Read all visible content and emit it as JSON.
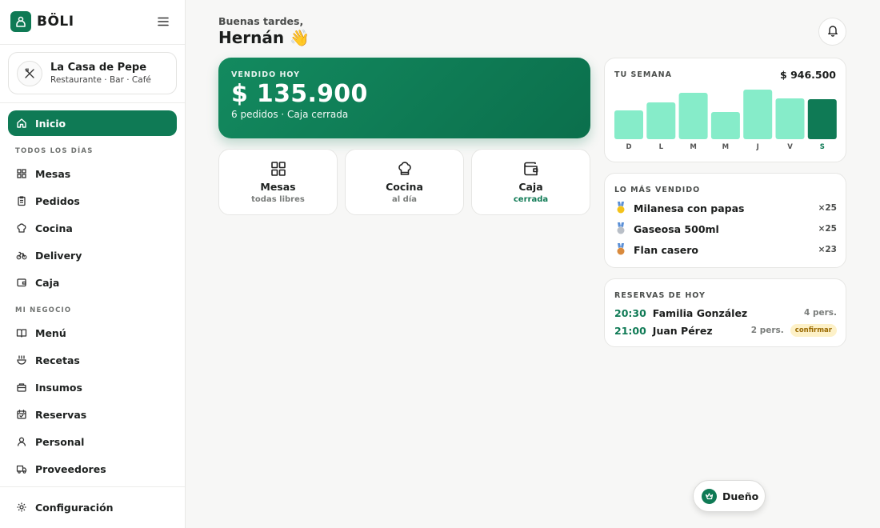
{
  "brand": {
    "name": "BÖLI",
    "accent": "#0f7a55"
  },
  "business": {
    "name": "La Casa de Pepe",
    "type": "Restaurante · Bar · Café"
  },
  "sidebar": {
    "active": {
      "label": "Inicio",
      "icon": "home-icon"
    },
    "section_daily": "TODOS LOS DÍAS",
    "daily": [
      {
        "label": "Mesas",
        "icon": "grid-icon"
      },
      {
        "label": "Pedidos",
        "icon": "clipboard-icon"
      },
      {
        "label": "Cocina",
        "icon": "chef-hat-icon"
      },
      {
        "label": "Delivery",
        "icon": "bike-icon"
      },
      {
        "label": "Caja",
        "icon": "wallet-icon"
      }
    ],
    "section_business": "MI NEGOCIO",
    "business": [
      {
        "label": "Menú",
        "icon": "book-icon"
      },
      {
        "label": "Recetas",
        "icon": "recipe-icon"
      },
      {
        "label": "Insumos",
        "icon": "box-icon"
      },
      {
        "label": "Reservas",
        "icon": "calendar-icon"
      },
      {
        "label": "Personal",
        "icon": "user-icon"
      },
      {
        "label": "Proveedores",
        "icon": "truck-icon"
      }
    ],
    "settings": {
      "label": "Configuración",
      "icon": "gear-icon"
    }
  },
  "header": {
    "greeting": "Buenas tardes,",
    "username": "Hernán 👋"
  },
  "sales": {
    "label": "VENDIDO HOY",
    "value": "$ 135.900",
    "summary": "6 pedidos · Caja cerrada"
  },
  "tiles": [
    {
      "label": "Mesas",
      "sub": "todas libres",
      "icon": "grid-icon"
    },
    {
      "label": "Cocina",
      "sub": "al día",
      "icon": "chef-hat-icon"
    },
    {
      "label": "Caja",
      "sub": "cerrada",
      "icon": "wallet-icon"
    }
  ],
  "week": {
    "title": "TU SEMANA",
    "total": "$ 946.500",
    "colors": {
      "bar": "#86ecc9",
      "current": "#0f7a55"
    },
    "chart_data": {
      "type": "bar",
      "categories": [
        "D",
        "L",
        "M",
        "M",
        "J",
        "V",
        "S"
      ],
      "values": [
        36,
        46,
        58,
        34,
        62,
        51,
        50
      ],
      "current_index": 6,
      "ylim": [
        0,
        62
      ]
    }
  },
  "top_sold": {
    "title": "LO MÁS VENDIDO",
    "items": [
      {
        "name": "Milanesa con papas",
        "qty": "×25",
        "medal": "#f3c21b"
      },
      {
        "name": "Gaseosa 500ml",
        "qty": "×25",
        "medal": "#b9bfc7"
      },
      {
        "name": "Flan casero",
        "qty": "×23",
        "medal": "#d98a3d"
      }
    ]
  },
  "reservations": {
    "title": "RESERVAS DE HOY",
    "items": [
      {
        "time": "20:30",
        "name": "Familia González",
        "people": "4 pers.",
        "badge": ""
      },
      {
        "time": "21:00",
        "name": "Juan Pérez",
        "people": "2 pers.",
        "badge": "confirmar"
      }
    ]
  },
  "role": {
    "label": "Dueño"
  }
}
